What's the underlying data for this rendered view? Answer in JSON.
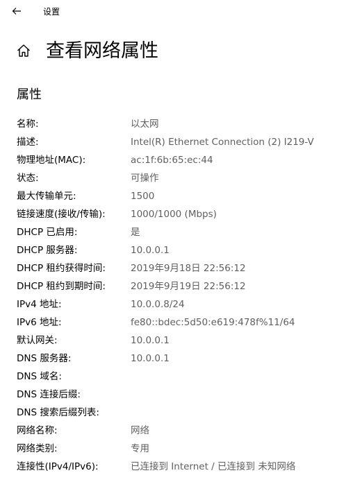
{
  "titlebar": {
    "title": "设置",
    "back_icon": "arrow-left-icon"
  },
  "header": {
    "title": "查看网络属性",
    "home_icon": "home-icon"
  },
  "section": {
    "title": "属性"
  },
  "properties": [
    {
      "label": "名称:",
      "value": "以太网"
    },
    {
      "label": "描述:",
      "value": "Intel(R) Ethernet Connection (2) I219-V"
    },
    {
      "label": "物理地址(MAC):",
      "value": "ac:1f:6b:65:ec:44"
    },
    {
      "label": "状态:",
      "value": "可操作"
    },
    {
      "label": "最大传输单元:",
      "value": "1500"
    },
    {
      "label": "链接速度(接收/传输):",
      "value": "1000/1000 (Mbps)"
    },
    {
      "label": "DHCP 已启用:",
      "value": "是"
    },
    {
      "label": "DHCP 服务器:",
      "value": "10.0.0.1"
    },
    {
      "label": "DHCP 租约获得时间:",
      "value": "2019年9月18日 22:56:12"
    },
    {
      "label": "DHCP 租约到期时间:",
      "value": "2019年9月19日 22:56:12"
    },
    {
      "label": "IPv4 地址:",
      "value": "10.0.0.8/24"
    },
    {
      "label": "IPv6 地址:",
      "value": "fe80::bdec:5d50:e619:478f%11/64"
    },
    {
      "label": "默认网关:",
      "value": "10.0.0.1"
    },
    {
      "label": "DNS 服务器:",
      "value": "10.0.0.1"
    },
    {
      "label": "DNS 域名:",
      "value": ""
    },
    {
      "label": "DNS 连接后缀:",
      "value": ""
    },
    {
      "label": "DNS 搜索后缀列表:",
      "value": ""
    },
    {
      "label": "网络名称:",
      "value": "网络"
    },
    {
      "label": "网络类别:",
      "value": "专用"
    },
    {
      "label": "连接性(IPv4/IPv6):",
      "value": "已连接到 Internet / 已连接到 未知网络"
    }
  ],
  "colors": {
    "label": "#000000",
    "value": "#5f5f5f",
    "background": "#ffffff"
  }
}
